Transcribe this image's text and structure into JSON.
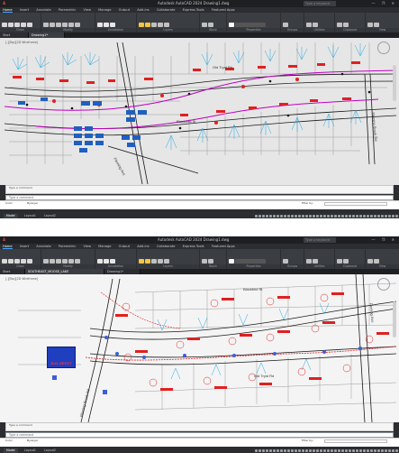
{
  "windows": [
    {
      "app_letter": "A",
      "title": "Autodesk AutoCAD 2024  Drawing1.dwg",
      "search_placeholder": "Type a keyword",
      "window_controls": "— ❐ ✕",
      "menu": [
        "Home",
        "Insert",
        "Annotate",
        "Parametric",
        "View",
        "Manage",
        "Output",
        "Add-ins",
        "Collaborate",
        "Express Tools",
        "Featured Apps"
      ],
      "ribbon_panels": [
        "Draw",
        "Modify",
        "Annotation",
        "Layers",
        "Block",
        "Properties",
        "Groups",
        "Utilities",
        "Clipboard",
        "View"
      ],
      "tabs": [
        "Start",
        "Drawing1*"
      ],
      "active_tab": 1,
      "viewport_label": "[-][Top][2D Wireframe]",
      "streets": [
        "Fleming Ave",
        "Old Tryst Rd",
        "Blackbird St",
        "Fleming Brook Rd"
      ],
      "cmd_log": "Type a command",
      "cmd_placeholder": "Type a command",
      "prop_key": "Color",
      "prop_val": "ByLayer",
      "filter_label": "Filter by:",
      "layouts": [
        "Model",
        "Layout1",
        "Layout2"
      ],
      "active_layout": 0
    },
    {
      "app_letter": "A",
      "title": "Autodesk AutoCAD 2024  Drawing1.dwg",
      "search_placeholder": "Type a keyword",
      "window_controls": "— ❐ ✕",
      "menu": [
        "Home",
        "Insert",
        "Annotate",
        "Parametric",
        "View",
        "Manage",
        "Output",
        "Add-ins",
        "Collaborate",
        "Express Tools",
        "Featured Apps"
      ],
      "ribbon_panels": [
        "Draw",
        "Modify",
        "Annotation",
        "Layers",
        "Block",
        "Properties",
        "Groups",
        "Utilities",
        "Clipboard",
        "View"
      ],
      "tabs": [
        "Start",
        "SOUTHEAST_MOOSE_LAKE",
        "Drawing1*"
      ],
      "active_tab": 1,
      "viewport_label": "[-][Top][2D Wireframe]",
      "bus_depot": "BUS DEPOT",
      "streets": [
        "Blackbird St",
        "Old Tryst Rd",
        "Fleming Brook Rd",
        "Fleming Ave"
      ],
      "cmd_log": "Type a command",
      "cmd_placeholder": "Type a command",
      "prop_key": "Color",
      "prop_val": "ByLayer",
      "filter_label": "Filter by:",
      "layouts": [
        "Model",
        "Layout1",
        "Layout2"
      ],
      "active_layout": 0
    }
  ],
  "colors": {
    "app_red": "#e24c3c",
    "road_line": "#1a1a1a",
    "lot_line": "#9a9a9a",
    "cyan_fixtures": "#29a8e0",
    "red_annotations": "#e02020",
    "magenta_route": "#c000c0",
    "blue_blocks": "#1f5fbf"
  }
}
